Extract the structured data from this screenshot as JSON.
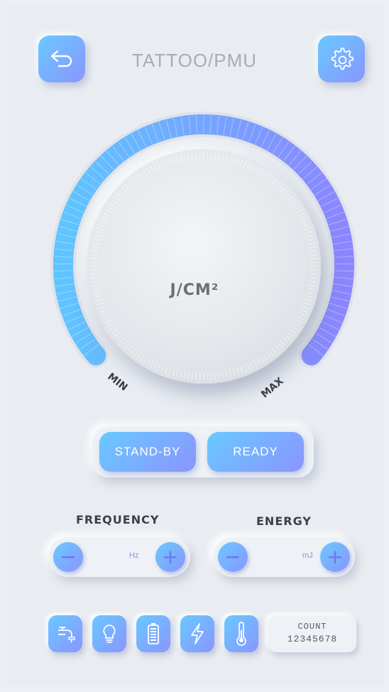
{
  "header": {
    "title": "TATTOO/PMU",
    "back_icon": "back-arrow-icon",
    "settings_icon": "gear-icon"
  },
  "dial": {
    "unit": "J/CM²",
    "min_label": "MIN",
    "max_label": "MAX",
    "level": 1.0
  },
  "mode": {
    "standby_label": "STAND-BY",
    "ready_label": "READY"
  },
  "frequency": {
    "label": "FREQUENCY",
    "unit": "Hz",
    "minus": "−",
    "plus": "+"
  },
  "energy": {
    "label": "ENERGY",
    "unit": "mJ",
    "minus": "−",
    "plus": "+"
  },
  "status": {
    "icons": [
      "water-tap-icon",
      "lightbulb-icon",
      "battery-icon",
      "lightning-icon",
      "thermometer-icon"
    ],
    "count_label": "COUNT",
    "count_value": "12345678"
  },
  "colors": {
    "accent_start": "#69c9ff",
    "accent_end": "#8a95ff",
    "background": "#e9edf2"
  }
}
